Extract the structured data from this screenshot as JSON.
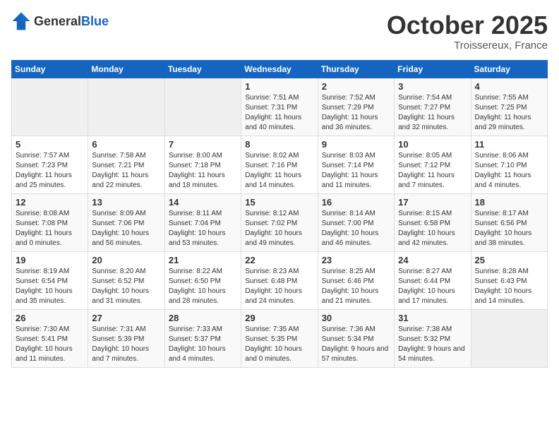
{
  "header": {
    "logo_general": "General",
    "logo_blue": "Blue",
    "month": "October 2025",
    "location": "Troissereux, France"
  },
  "days_of_week": [
    "Sunday",
    "Monday",
    "Tuesday",
    "Wednesday",
    "Thursday",
    "Friday",
    "Saturday"
  ],
  "weeks": [
    [
      {
        "day": "",
        "info": ""
      },
      {
        "day": "",
        "info": ""
      },
      {
        "day": "",
        "info": ""
      },
      {
        "day": "1",
        "info": "Sunrise: 7:51 AM\nSunset: 7:31 PM\nDaylight: 11 hours\nand 40 minutes."
      },
      {
        "day": "2",
        "info": "Sunrise: 7:52 AM\nSunset: 7:29 PM\nDaylight: 11 hours\nand 36 minutes."
      },
      {
        "day": "3",
        "info": "Sunrise: 7:54 AM\nSunset: 7:27 PM\nDaylight: 11 hours\nand 32 minutes."
      },
      {
        "day": "4",
        "info": "Sunrise: 7:55 AM\nSunset: 7:25 PM\nDaylight: 11 hours\nand 29 minutes."
      }
    ],
    [
      {
        "day": "5",
        "info": "Sunrise: 7:57 AM\nSunset: 7:23 PM\nDaylight: 11 hours\nand 25 minutes."
      },
      {
        "day": "6",
        "info": "Sunrise: 7:58 AM\nSunset: 7:21 PM\nDaylight: 11 hours\nand 22 minutes."
      },
      {
        "day": "7",
        "info": "Sunrise: 8:00 AM\nSunset: 7:18 PM\nDaylight: 11 hours\nand 18 minutes."
      },
      {
        "day": "8",
        "info": "Sunrise: 8:02 AM\nSunset: 7:16 PM\nDaylight: 11 hours\nand 14 minutes."
      },
      {
        "day": "9",
        "info": "Sunrise: 8:03 AM\nSunset: 7:14 PM\nDaylight: 11 hours\nand 11 minutes."
      },
      {
        "day": "10",
        "info": "Sunrise: 8:05 AM\nSunset: 7:12 PM\nDaylight: 11 hours\nand 7 minutes."
      },
      {
        "day": "11",
        "info": "Sunrise: 8:06 AM\nSunset: 7:10 PM\nDaylight: 11 hours\nand 4 minutes."
      }
    ],
    [
      {
        "day": "12",
        "info": "Sunrise: 8:08 AM\nSunset: 7:08 PM\nDaylight: 11 hours\nand 0 minutes."
      },
      {
        "day": "13",
        "info": "Sunrise: 8:09 AM\nSunset: 7:06 PM\nDaylight: 10 hours\nand 56 minutes."
      },
      {
        "day": "14",
        "info": "Sunrise: 8:11 AM\nSunset: 7:04 PM\nDaylight: 10 hours\nand 53 minutes."
      },
      {
        "day": "15",
        "info": "Sunrise: 8:12 AM\nSunset: 7:02 PM\nDaylight: 10 hours\nand 49 minutes."
      },
      {
        "day": "16",
        "info": "Sunrise: 8:14 AM\nSunset: 7:00 PM\nDaylight: 10 hours\nand 46 minutes."
      },
      {
        "day": "17",
        "info": "Sunrise: 8:15 AM\nSunset: 6:58 PM\nDaylight: 10 hours\nand 42 minutes."
      },
      {
        "day": "18",
        "info": "Sunrise: 8:17 AM\nSunset: 6:56 PM\nDaylight: 10 hours\nand 38 minutes."
      }
    ],
    [
      {
        "day": "19",
        "info": "Sunrise: 8:19 AM\nSunset: 6:54 PM\nDaylight: 10 hours\nand 35 minutes."
      },
      {
        "day": "20",
        "info": "Sunrise: 8:20 AM\nSunset: 6:52 PM\nDaylight: 10 hours\nand 31 minutes."
      },
      {
        "day": "21",
        "info": "Sunrise: 8:22 AM\nSunset: 6:50 PM\nDaylight: 10 hours\nand 28 minutes."
      },
      {
        "day": "22",
        "info": "Sunrise: 8:23 AM\nSunset: 6:48 PM\nDaylight: 10 hours\nand 24 minutes."
      },
      {
        "day": "23",
        "info": "Sunrise: 8:25 AM\nSunset: 6:46 PM\nDaylight: 10 hours\nand 21 minutes."
      },
      {
        "day": "24",
        "info": "Sunrise: 8:27 AM\nSunset: 6:44 PM\nDaylight: 10 hours\nand 17 minutes."
      },
      {
        "day": "25",
        "info": "Sunrise: 8:28 AM\nSunset: 6:43 PM\nDaylight: 10 hours\nand 14 minutes."
      }
    ],
    [
      {
        "day": "26",
        "info": "Sunrise: 7:30 AM\nSunset: 5:41 PM\nDaylight: 10 hours\nand 11 minutes."
      },
      {
        "day": "27",
        "info": "Sunrise: 7:31 AM\nSunset: 5:39 PM\nDaylight: 10 hours\nand 7 minutes."
      },
      {
        "day": "28",
        "info": "Sunrise: 7:33 AM\nSunset: 5:37 PM\nDaylight: 10 hours\nand 4 minutes."
      },
      {
        "day": "29",
        "info": "Sunrise: 7:35 AM\nSunset: 5:35 PM\nDaylight: 10 hours\nand 0 minutes."
      },
      {
        "day": "30",
        "info": "Sunrise: 7:36 AM\nSunset: 5:34 PM\nDaylight: 9 hours\nand 57 minutes."
      },
      {
        "day": "31",
        "info": "Sunrise: 7:38 AM\nSunset: 5:32 PM\nDaylight: 9 hours\nand 54 minutes."
      },
      {
        "day": "",
        "info": ""
      }
    ]
  ]
}
